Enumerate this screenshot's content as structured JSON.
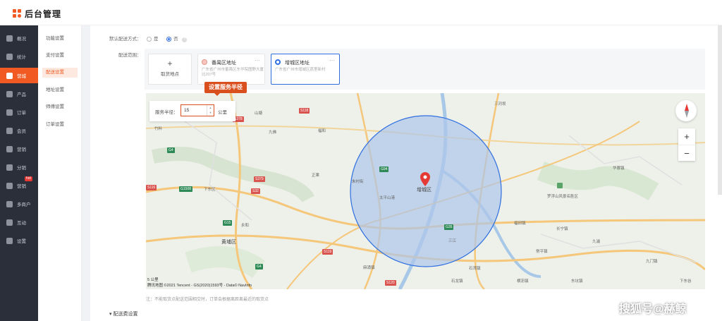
{
  "app": {
    "title": "后台管理"
  },
  "sidebar": {
    "items": [
      {
        "label": "概况",
        "icon": "dashboard-icon"
      },
      {
        "label": "统计",
        "icon": "bar-chart-icon"
      },
      {
        "label": "营城",
        "icon": "shop-icon"
      },
      {
        "label": "产品",
        "icon": "box-icon"
      },
      {
        "label": "订单",
        "icon": "list-icon"
      },
      {
        "label": "会员",
        "icon": "crown-icon"
      },
      {
        "label": "营销",
        "icon": "gift-icon"
      },
      {
        "label": "分销",
        "icon": "share-icon"
      },
      {
        "label": "营销",
        "icon": "flag-icon",
        "badge": "hot"
      },
      {
        "label": "多商户",
        "icon": "grid-icon"
      },
      {
        "label": "互动",
        "icon": "users-icon"
      },
      {
        "label": "设置",
        "icon": "gear-icon"
      }
    ]
  },
  "subnav": {
    "items": [
      "功能设置",
      "支付设置",
      "配送设置",
      "地址设置",
      "师傅设置",
      "订单设置"
    ]
  },
  "form": {
    "default_delivery_label": "默认配送方式：",
    "opt_yes": "是",
    "opt_no": "否",
    "help_mark": "?",
    "range_label": "配送范围："
  },
  "cards": {
    "add_plus": "+",
    "add_label": "取货地点",
    "more": "···",
    "items": [
      {
        "title": "番禺区地址",
        "address": "广东省广州市番禺区东华院图野大厦比207号",
        "dot": "#f7c6c0"
      },
      {
        "title": "增城区地址",
        "address": "广东省广州市增城区荔里新村",
        "dot": "#2f6fe0"
      }
    ]
  },
  "map": {
    "tooltip": "设置服务半径",
    "radius_label": "服务半径：",
    "radius_value": "15",
    "radius_unit": "公里",
    "spin_up": "▲",
    "spin_down": "▼",
    "zoom_in": "+",
    "zoom_out": "−",
    "scale": "5 公里",
    "attribution": "腾讯地图 ©2021 Tencent - GS(2020)1593号 - Data© NavInfo",
    "center_label": "增城区",
    "places": [
      "竹料",
      "九佛",
      "山塘",
      "福和",
      "正果",
      "三河坝",
      "太平山港",
      "朱村街",
      "石湾镇",
      "三江",
      "黄埔区",
      "永和",
      "下东区",
      "长宁镇",
      "罗浮山风景名胜区",
      "福田镇",
      "麻涌镇",
      "石龙镇",
      "横沥镇",
      "东坑镇",
      "常平镇",
      "下东谷",
      "九浦",
      "九门镇",
      "华蓉镇"
    ],
    "roads": [
      "G94",
      "S118",
      "G4",
      "G1508",
      "G35",
      "S379",
      "S32",
      "G15",
      "S116",
      "S119",
      "S120",
      "G4",
      "S378"
    ]
  },
  "note": "注：不能取货点配送范围相交时，订单会根据离距离最近的取货点",
  "fee_label": "配送费设置",
  "watermark": "搜狐号@赫鲸",
  "colors": {
    "accent": "#f15a22",
    "primary": "#2f6fe0",
    "circle_fill": "#aec6ea",
    "circle_stroke": "#2f6fe0"
  }
}
